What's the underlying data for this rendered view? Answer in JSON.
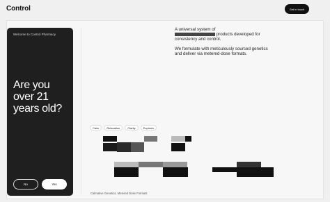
{
  "header": {
    "logo": "Control",
    "cta_label": "Get in touch"
  },
  "age_gate": {
    "welcome": "Welcome to Control Pharmacy",
    "question": "Are you over 21 years old?",
    "no_label": "No",
    "yes_label": "Yes"
  },
  "intro": {
    "line1_prefix": "A universal system of",
    "line1_suffix": "products developed for consistency and control.",
    "paragraph2": "We formulate with meticulously sourced genetics and deliver via metered-dose formats."
  },
  "tags": [
    "Calm",
    "Relaxation",
    "Clarity",
    "Euphoric"
  ],
  "caption": "Calmative Genetics, Metered Dose Formats",
  "colors": {
    "dark": "#111111",
    "card": "#1f1f1f",
    "background": "#f0f0f0"
  }
}
